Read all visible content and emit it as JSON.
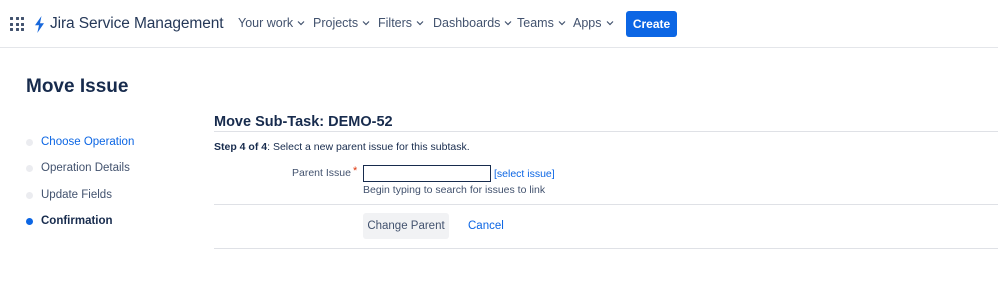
{
  "header": {
    "app_name": "Jira Service Management",
    "nav": [
      {
        "label": "Your work"
      },
      {
        "label": "Projects"
      },
      {
        "label": "Filters"
      },
      {
        "label": "Dashboards"
      },
      {
        "label": "Teams"
      },
      {
        "label": "Apps"
      }
    ],
    "create_label": "Create",
    "accent_color": "#0c66e4",
    "icons": [
      "app-switcher-icon",
      "jira-logo-icon",
      "chevron-down-icon"
    ]
  },
  "page": {
    "title": "Move Issue",
    "steps": [
      {
        "label": "Choose Operation",
        "state": "link"
      },
      {
        "label": "Operation Details",
        "state": "inactive"
      },
      {
        "label": "Update Fields",
        "state": "inactive"
      },
      {
        "label": "Confirmation",
        "state": "active"
      }
    ]
  },
  "form": {
    "title": "Move Sub-Task: DEMO-52",
    "step_prefix": "Step 4 of 4",
    "step_text": ": Select a new parent issue for this subtask.",
    "parent_label": "Parent Issue",
    "required_marker": "*",
    "parent_value": "",
    "select_issue_link": "[select issue]",
    "hint": "Begin typing to search for issues to link",
    "submit_label": "Change Parent",
    "cancel_label": "Cancel"
  }
}
